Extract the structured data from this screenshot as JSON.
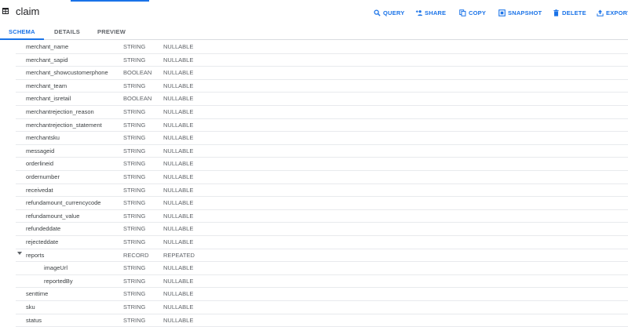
{
  "table": {
    "title": "claim"
  },
  "actions": [
    {
      "id": "query",
      "label": "QUERY",
      "icon": "search-icon"
    },
    {
      "id": "share",
      "label": "SHARE",
      "icon": "person-add-icon"
    },
    {
      "id": "copy",
      "label": "COPY",
      "icon": "copy-icon"
    },
    {
      "id": "snapshot",
      "label": "SNAPSHOT",
      "icon": "snapshot-icon"
    },
    {
      "id": "delete",
      "label": "DELETE",
      "icon": "trash-icon"
    },
    {
      "id": "export",
      "label": "EXPORT",
      "icon": "export-icon"
    }
  ],
  "tabs": [
    {
      "label": "SCHEMA",
      "active": true
    },
    {
      "label": "DETAILS",
      "active": false
    },
    {
      "label": "PREVIEW",
      "active": false
    }
  ],
  "schema": [
    {
      "name": "merchant_name",
      "type": "STRING",
      "mode": "NULLABLE"
    },
    {
      "name": "merchant_sapid",
      "type": "STRING",
      "mode": "NULLABLE"
    },
    {
      "name": "merchant_showcustomerphone",
      "type": "BOOLEAN",
      "mode": "NULLABLE"
    },
    {
      "name": "merchant_team",
      "type": "STRING",
      "mode": "NULLABLE"
    },
    {
      "name": "merchant_isretail",
      "type": "BOOLEAN",
      "mode": "NULLABLE"
    },
    {
      "name": "merchantrejection_reason",
      "type": "STRING",
      "mode": "NULLABLE"
    },
    {
      "name": "merchantrejection_statement",
      "type": "STRING",
      "mode": "NULLABLE"
    },
    {
      "name": "merchantsku",
      "type": "STRING",
      "mode": "NULLABLE"
    },
    {
      "name": "messageid",
      "type": "STRING",
      "mode": "NULLABLE"
    },
    {
      "name": "orderlineid",
      "type": "STRING",
      "mode": "NULLABLE"
    },
    {
      "name": "ordernumber",
      "type": "STRING",
      "mode": "NULLABLE"
    },
    {
      "name": "receivedat",
      "type": "STRING",
      "mode": "NULLABLE"
    },
    {
      "name": "refundamount_currencycode",
      "type": "STRING",
      "mode": "NULLABLE"
    },
    {
      "name": "refundamount_value",
      "type": "STRING",
      "mode": "NULLABLE"
    },
    {
      "name": "refundeddate",
      "type": "STRING",
      "mode": "NULLABLE"
    },
    {
      "name": "rejecteddate",
      "type": "STRING",
      "mode": "NULLABLE"
    },
    {
      "name": "reports",
      "type": "RECORD",
      "mode": "REPEATED",
      "expanded": true
    },
    {
      "name": "imageUrl",
      "type": "STRING",
      "mode": "NULLABLE",
      "nested": true
    },
    {
      "name": "reportedBy",
      "type": "STRING",
      "mode": "NULLABLE",
      "nested": true
    },
    {
      "name": "senttime",
      "type": "STRING",
      "mode": "NULLABLE"
    },
    {
      "name": "sku",
      "type": "STRING",
      "mode": "NULLABLE"
    },
    {
      "name": "status",
      "type": "STRING",
      "mode": "NULLABLE"
    }
  ],
  "colors": {
    "accent": "#1a73e8",
    "text": "#202124",
    "muted": "#5f6368",
    "divider": "#e8eaed"
  }
}
